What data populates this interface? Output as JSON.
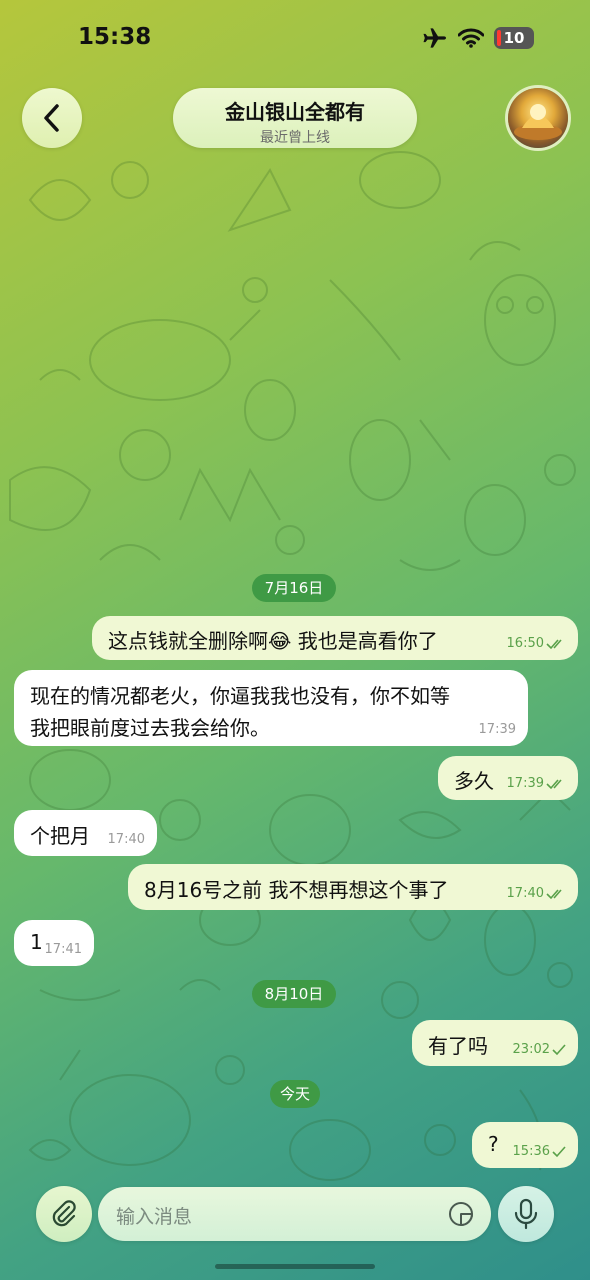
{
  "status_bar": {
    "time": "15:38",
    "battery": "10",
    "icons": [
      "airplane-icon",
      "wifi-icon",
      "battery-icon"
    ]
  },
  "header": {
    "title": "金山银山全都有",
    "subtitle": "最近曾上线",
    "back_icon": "chevron-left-icon",
    "avatar": "profile-avatar"
  },
  "dates": [
    "7月16日",
    "8月10日",
    "今天"
  ],
  "messages": [
    {
      "text": "这点钱就全删除啊😂  我也是高看你了",
      "time": "16:50",
      "dir": "out",
      "status": "read"
    },
    {
      "text_lines": [
        "现在的情况都老火，你逼我我也没有，你不如等",
        "我把眼前度过去我会给你。"
      ],
      "time": "17:39",
      "dir": "in"
    },
    {
      "text": "多久",
      "time": "17:39",
      "dir": "out",
      "status": "read"
    },
    {
      "text": "个把月",
      "time": "17:40",
      "dir": "in"
    },
    {
      "text": "8月16号之前  我不想再想这个事了",
      "time": "17:40",
      "dir": "out",
      "status": "read"
    },
    {
      "text": "1",
      "time": "17:41",
      "dir": "in"
    },
    {
      "text": "有了吗",
      "time": "23:02",
      "dir": "out",
      "status": "sent"
    },
    {
      "text": "?",
      "time": "15:36",
      "dir": "out",
      "status": "sent"
    }
  ],
  "input": {
    "placeholder": "输入消息",
    "attach_icon": "paperclip-icon",
    "sticker_icon": "sticker-icon",
    "mic_icon": "microphone-icon"
  },
  "colors": {
    "outgoing_bubble": "#f0f8d4",
    "incoming_bubble": "#ffffff",
    "date_pill": "#3f9a45",
    "check": "#5aa14a"
  }
}
